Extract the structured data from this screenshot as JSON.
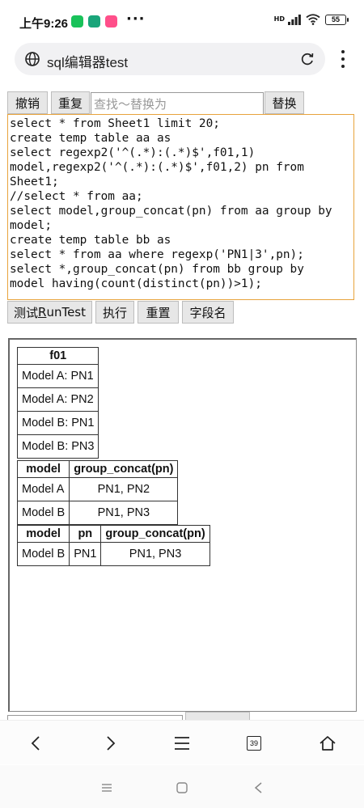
{
  "status_bar": {
    "time": "上午9:26",
    "more": "···",
    "network": "HD",
    "battery": "55",
    "app_icons": [
      {
        "name": "wechat-icon",
        "color": "#19c25a"
      },
      {
        "name": "shield-app-icon",
        "color": "#1aa57a"
      },
      {
        "name": "tmall-icon",
        "color": "#ff4f8a"
      }
    ]
  },
  "browser": {
    "url_text": "sql编辑器test",
    "tab_count": "39"
  },
  "toolbar": {
    "undo_label": "撤销",
    "redo_label": "重复",
    "find_placeholder": "查找～替换为",
    "replace_label": "替换"
  },
  "editor": {
    "lines": [
      "select * from Sheet1 limit 20;",
      "create temp table aa as",
      "select regexp2('^(.*):(.*)$',f01,1)",
      "model,regexp2('^(.*):(.*)$',f01,2) pn from",
      "Sheet1;",
      "//select * from aa;",
      "select model,group_concat(pn) from aa group by",
      "model;",
      "create temp table bb as",
      "select * from aa where regexp('PN1|3',pn);",
      "select *,group_concat(pn) from bb group by",
      "model having(count(distinct(pn))>1);"
    ]
  },
  "actions": {
    "run_test_label_pre": "测试",
    "run_test_label_underlined": "R",
    "run_test_label_post": "unTest",
    "execute_label": "执行",
    "reset_label": "重置",
    "fields_label": "字段名"
  },
  "results": {
    "table1": {
      "headers": [
        "f01"
      ],
      "rows": [
        [
          "Model A: PN1"
        ],
        [
          "Model A: PN2"
        ],
        [
          "Model B: PN1"
        ],
        [
          "Model B: PN3"
        ]
      ]
    },
    "table2": {
      "headers": [
        "model",
        "group_concat(pn)"
      ],
      "rows": [
        [
          "Model A",
          "PN1, PN2"
        ],
        [
          "Model B",
          "PN1, PN3"
        ]
      ]
    },
    "table3": {
      "headers": [
        "model",
        "pn",
        "group_concat(pn)"
      ],
      "rows": [
        [
          "Model B",
          "PN1",
          "PN1, PN3"
        ]
      ]
    }
  }
}
